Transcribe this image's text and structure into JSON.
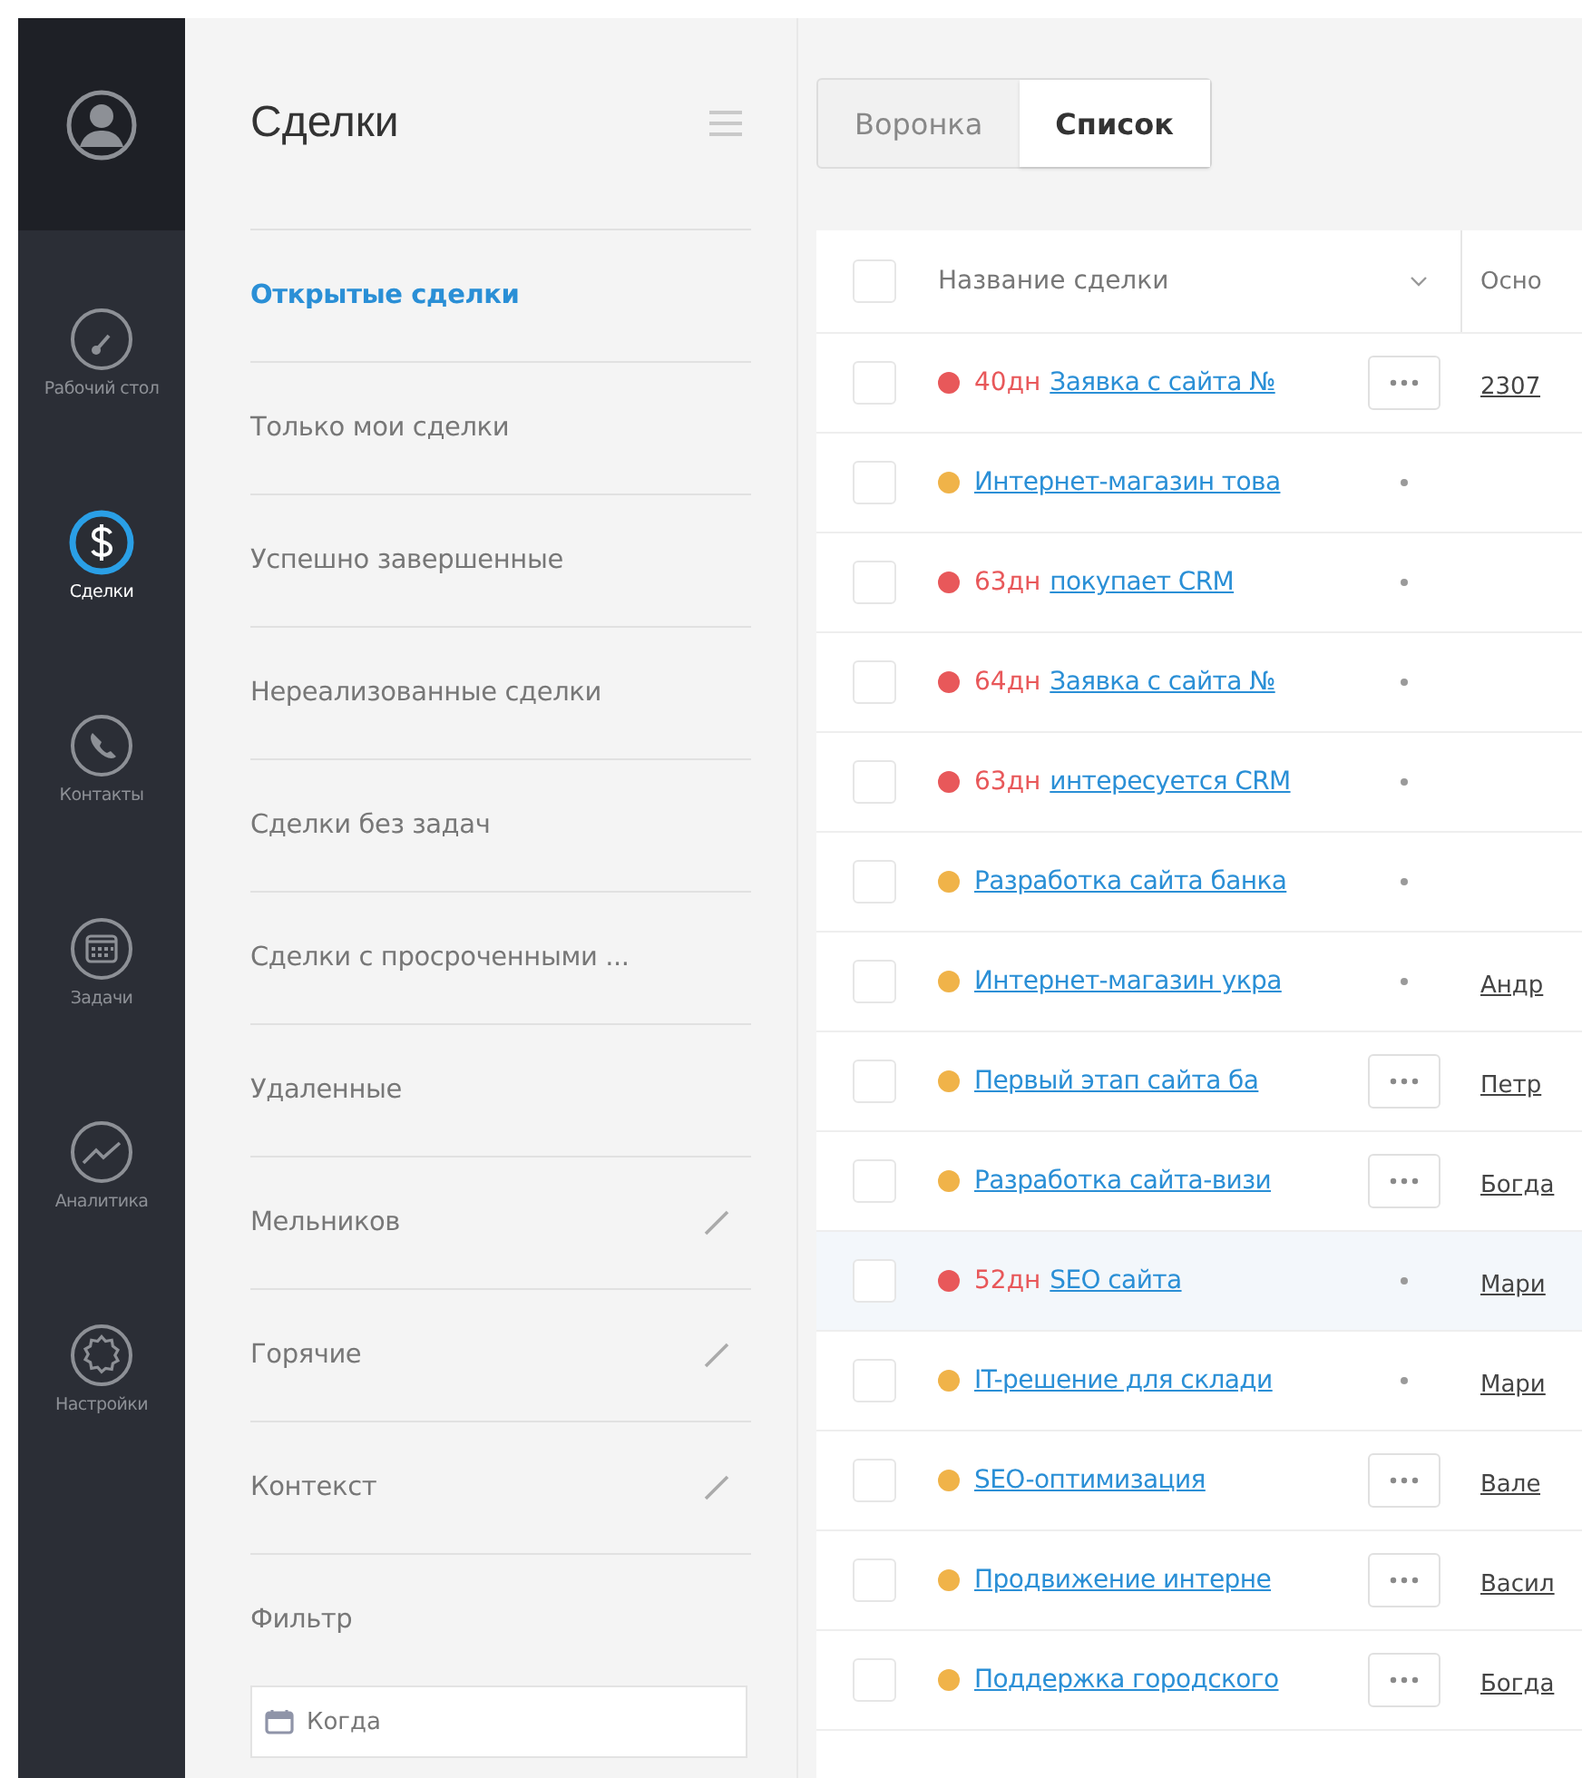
{
  "nav": {
    "items": [
      {
        "kind": "dashboard",
        "label": "Рабочий стол",
        "selected": false
      },
      {
        "kind": "deals",
        "label": "Сделки",
        "selected": true
      },
      {
        "kind": "contacts",
        "label": "Контакты",
        "selected": false
      },
      {
        "kind": "tasks",
        "label": "Задачи",
        "selected": false
      },
      {
        "kind": "analytics",
        "label": "Аналитика",
        "selected": false
      },
      {
        "kind": "settings",
        "label": "Настройки",
        "selected": false
      }
    ]
  },
  "filters": {
    "title": "Сделки",
    "items": [
      {
        "label": "Открытые сделки",
        "selected": true,
        "editable": false
      },
      {
        "label": "Только мои сделки",
        "selected": false,
        "editable": false
      },
      {
        "label": "Успешно завершенные",
        "selected": false,
        "editable": false
      },
      {
        "label": "Нереализованные сделки",
        "selected": false,
        "editable": false
      },
      {
        "label": "Сделки без задач",
        "selected": false,
        "editable": false
      },
      {
        "label": "Сделки с просроченными ...",
        "selected": false,
        "editable": false
      },
      {
        "label": "Удаленные",
        "selected": false,
        "editable": false
      },
      {
        "label": "Мельников",
        "selected": false,
        "editable": true
      },
      {
        "label": "Горячие",
        "selected": false,
        "editable": true
      },
      {
        "label": "Контекст",
        "selected": false,
        "editable": true
      }
    ],
    "filter_label": "Фильтр",
    "date_field": {
      "placeholder": "Когда"
    }
  },
  "tabs": [
    {
      "label": "Воронка",
      "selected": false
    },
    {
      "label": "Список",
      "selected": true
    }
  ],
  "table": {
    "all_checked": false,
    "columns": [
      "Название сделки",
      "Осно"
    ],
    "rows": [
      {
        "kind": "more",
        "checked": false,
        "selected": false,
        "color": "#e8585a",
        "days": "40дн",
        "name": "Заявка с сайта №",
        "column_2": "2307"
      },
      {
        "kind": "dot",
        "checked": false,
        "selected": false,
        "color": "#f0b349",
        "name": "Интернет-магазин това"
      },
      {
        "kind": "dot",
        "checked": false,
        "selected": false,
        "color": "#e8585a",
        "days": "63дн",
        "name": "покупает CRM"
      },
      {
        "kind": "dot",
        "checked": false,
        "selected": false,
        "color": "#e8585a",
        "days": "64дн",
        "name": "Заявка с сайта №"
      },
      {
        "kind": "dot",
        "checked": false,
        "selected": false,
        "color": "#e8585a",
        "days": "63дн",
        "name": "интересуется CRM"
      },
      {
        "kind": "dot",
        "checked": false,
        "selected": false,
        "color": "#f0b349",
        "name": "Разработка сайта банка"
      },
      {
        "kind": "dot",
        "checked": false,
        "selected": false,
        "color": "#f0b349",
        "name": "Интернет-магазин укра",
        "column_2": "Андр"
      },
      {
        "kind": "more",
        "checked": false,
        "selected": false,
        "color": "#f0b349",
        "name": "Первый этап сайта ба",
        "column_2": "Петр"
      },
      {
        "kind": "more",
        "checked": false,
        "selected": false,
        "color": "#f0b349",
        "name": "Разработка сайта-визи",
        "column_2": "Богда"
      },
      {
        "kind": "dot",
        "checked": false,
        "selected": true,
        "color": "#e8585a",
        "days": "52дн",
        "name": "SEO сайта",
        "column_2": "Мари"
      },
      {
        "kind": "dot",
        "checked": false,
        "selected": false,
        "color": "#f0b349",
        "name": "IT-решение для склади",
        "column_2": "Мари"
      },
      {
        "kind": "more",
        "checked": false,
        "selected": false,
        "color": "#f0b349",
        "name": "SEO-оптимизация",
        "column_2": "Вале"
      },
      {
        "kind": "more",
        "checked": false,
        "selected": false,
        "color": "#f0b349",
        "name": "Продвижение интерне",
        "column_2": "Васил"
      },
      {
        "kind": "more",
        "checked": false,
        "selected": false,
        "color": "#f0b349",
        "name": "Поддержка городского",
        "column_2": "Богда"
      }
    ]
  }
}
